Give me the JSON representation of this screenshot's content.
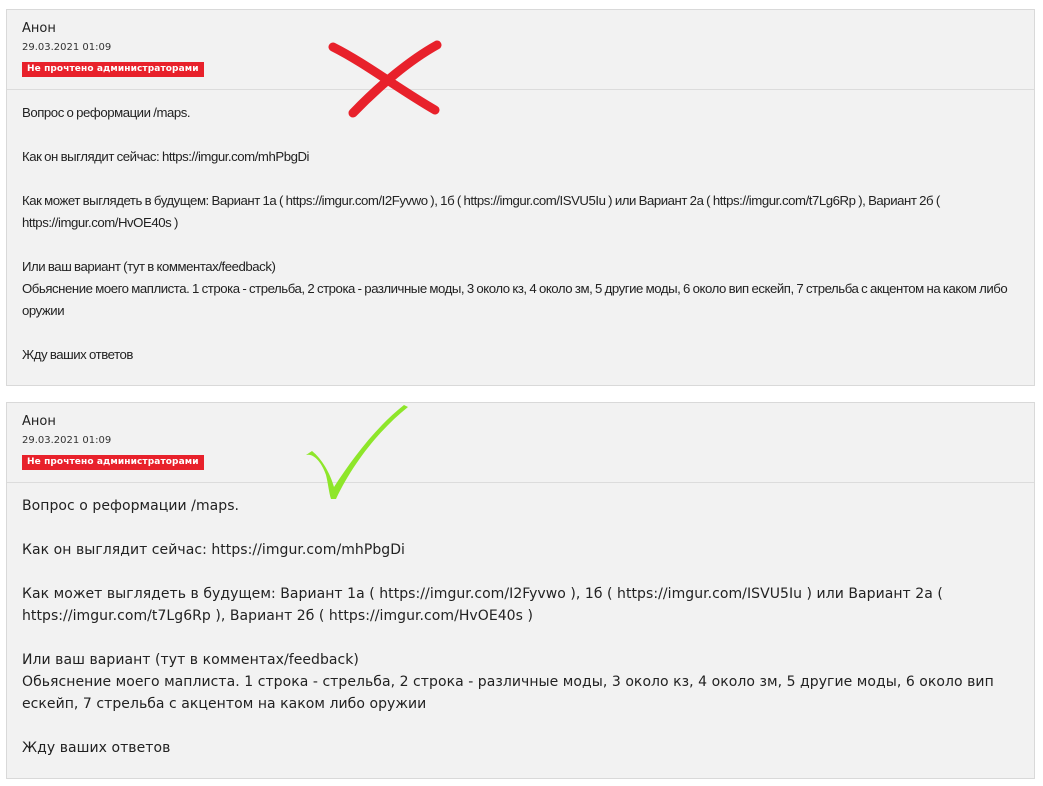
{
  "posts": [
    {
      "author": "Анон",
      "date": "29.03.2021 01:09",
      "badge": "Не прочтено администраторами",
      "lines": [
        "Вопрос о реформации /maps.",
        "",
        "Как он выглядит сейчас: https://imgur.com/mhPbgDi",
        "",
        "Как может выглядеть в будущем: Вариант 1а ( https://imgur.com/I2Fyvwo ), 1б ( https://imgur.com/ISVU5Iu ) или Вариант 2а ( https://imgur.com/t7Lg6Rp ), Вариант 2б ( https://imgur.com/HvOE40s )",
        "",
        "Или ваш вариант (тут в комментах/feedback)",
        "Обьяснение моего маплиста. 1 строка - стрельба, 2 строка - различные моды, 3 около кз, 4 около зм, 5 другие моды, 6 около вип ескейп, 7 стрельба с акцентом на каком либо оружии",
        "",
        "Жду ваших ответов"
      ],
      "mark": "cross-mark-icon",
      "mark_color": "#e8212b"
    },
    {
      "author": "Анон",
      "date": "29.03.2021 01:09",
      "badge": "Не прочтено администраторами",
      "lines": [
        "Вопрос о реформации /maps.",
        "",
        "Как он выглядит сейчас: https://imgur.com/mhPbgDi",
        "",
        "Как может выглядеть в будущем: Вариант 1а ( https://imgur.com/I2Fyvwo ), 1б ( https://imgur.com/ISVU5Iu ) или Вариант 2а ( https://imgur.com/t7Lg6Rp ), Вариант 2б ( https://imgur.com/HvOE40s )",
        "",
        "Или ваш вариант (тут в комментах/feedback)",
        "Обьяснение моего маплиста. 1 строка - стрельба, 2 строка - различные моды, 3 около кз, 4 около зм, 5 другие моды, 6 около вип ескейп, 7 стрельба с акцентом на каком либо оружии",
        "",
        "Жду ваших ответов"
      ],
      "mark": "check-mark-icon",
      "mark_color": "#8ee62a"
    }
  ]
}
